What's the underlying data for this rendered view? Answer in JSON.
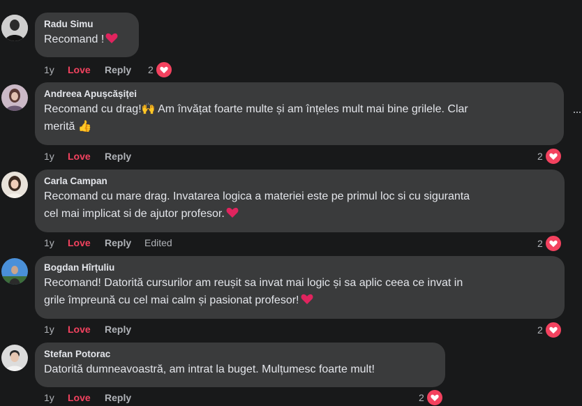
{
  "comments": [
    {
      "author": "Radu Simu",
      "text": "Recomand !",
      "emoji": "heart",
      "age": "1y",
      "love": "Love",
      "reply": "Reply",
      "edited": "",
      "reaction_count": "2"
    },
    {
      "author": "Andreea Apușcășiței",
      "text_line1": "Recomand cu drag!🙌 Am învățat foarte multe și am înțeles mult mai bine grilele. Clar",
      "text_line2": "merită 👍",
      "age": "1y",
      "love": "Love",
      "reply": "Reply",
      "edited": "",
      "reaction_count": "2"
    },
    {
      "author": "Carla Campan",
      "text_line1": "Recomand cu mare drag. Invatarea logica a materiei este pe primul loc si cu siguranta",
      "text_line2": "cel mai implicat si de ajutor profesor.",
      "emoji": "heart",
      "age": "1y",
      "love": "Love",
      "reply": "Reply",
      "edited": "Edited",
      "reaction_count": "2"
    },
    {
      "author": "Bogdan Hîrțuliu",
      "text_line1": "Recomand! Datorită cursurilor am reușit sa invat mai logic și sa aplic ceea ce invat in",
      "text_line2": "grile împreună cu cel mai calm și pasionat profesor!",
      "emoji": "heart",
      "age": "1y",
      "love": "Love",
      "reply": "Reply",
      "edited": "",
      "reaction_count": "2"
    },
    {
      "author": "Stefan Potorac",
      "text": "Datorită dumneavoastră, am intrat la buget. Mulțumesc foarte mult!",
      "age": "1y",
      "love": "Love",
      "reply": "Reply",
      "edited": "",
      "reaction_count": "2"
    }
  ],
  "more_options": "···",
  "colors": {
    "background": "#18191a",
    "bubble": "#3a3b3c",
    "love_accent": "#f3425f",
    "muted_text": "#b0b3b8",
    "primary_text": "#e4e6eb"
  }
}
